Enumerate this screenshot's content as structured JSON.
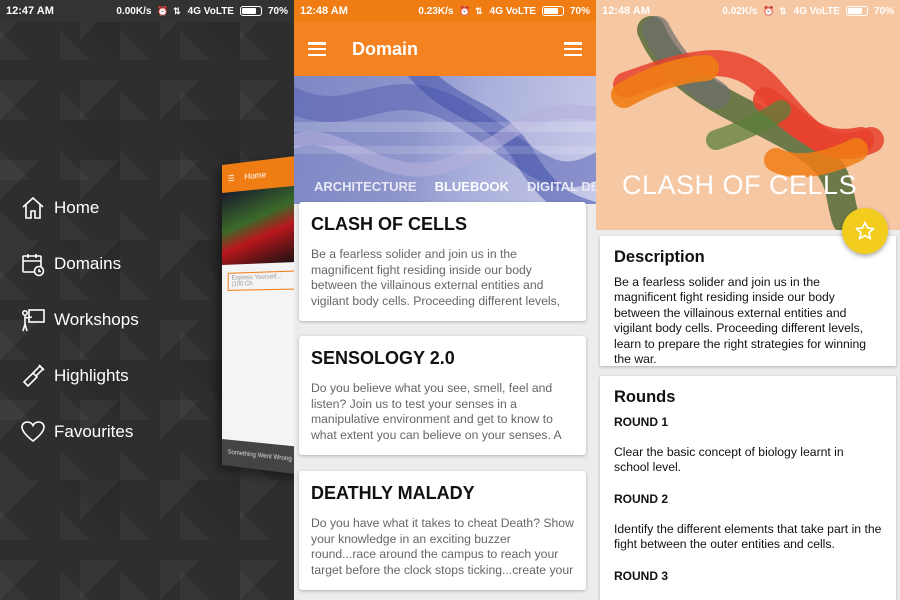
{
  "screen1": {
    "status": {
      "time": "12:47 AM",
      "speed": "0.00K/s",
      "network": "4G VoLTE",
      "battery": "70%"
    },
    "nav": [
      {
        "label": "Home",
        "icon": "home-icon"
      },
      {
        "label": "Domains",
        "icon": "calendar-icon"
      },
      {
        "label": "Workshops",
        "icon": "presentation-icon"
      },
      {
        "label": "Highlights",
        "icon": "flashlight-icon"
      },
      {
        "label": "Favourites",
        "icon": "heart-icon"
      }
    ],
    "preview": {
      "title": "Home",
      "input_placeholder": "Express Yourself... (100 Ch",
      "footer": "Something Went Wrong"
    }
  },
  "screen2": {
    "status": {
      "time": "12:48 AM",
      "speed": "0.23K/s",
      "network": "4G VoLTE",
      "battery": "70%"
    },
    "toolbar": {
      "title": "Domain"
    },
    "tabs": [
      "ARCHITECTURE",
      "BLUEBOOK",
      "DIGITAL DESIGN"
    ],
    "active_tab": "BLUEBOOK",
    "cards": [
      {
        "title": "CLASH OF CELLS",
        "desc": "Be a fearless solider and join us in the magnificent fight residing inside our body between the villainous external entities and vigilant body cells. Proceeding different levels, learn to prepare the ri..."
      },
      {
        "title": "SENSOLOGY 2.0",
        "desc": "Do you believe what you see, smell, feel and listen? Join us to test your senses in a manipulative environment and get to know to what extent you can believe on your senses. A fun way to explore t..."
      },
      {
        "title": "DEATHLY MALADY",
        "desc": "Do you have what it takes to cheat Death? Show your knowledge in an exciting buzzer round...race around the campus to reach your target before the clock stops ticking...create your own breed of ..."
      }
    ]
  },
  "screen3": {
    "status": {
      "time": "12:48 AM",
      "speed": "0.02K/s",
      "network": "4G VoLTE",
      "battery": "70%"
    },
    "hero_title": "CLASH OF CELLS",
    "description": {
      "heading": "Description",
      "text": "Be a fearless solider and join us in the magnificent fight residing inside our body between the villainous external entities and vigilant body cells. Proceeding different levels, learn to prepare the right strategies for winning the war."
    },
    "rounds": {
      "heading": "Rounds",
      "items": [
        {
          "label": "ROUND 1",
          "text": "Clear the basic concept of biology learnt in school level."
        },
        {
          "label": "ROUND 2",
          "text": "Identify the different elements that take part in the fight between the outer entities and cells."
        },
        {
          "label": "ROUND 3",
          "text": ""
        }
      ]
    }
  },
  "colors": {
    "accent": "#f58220",
    "fab": "#f3cd1e",
    "hero_bg": "#f6c7a3"
  }
}
